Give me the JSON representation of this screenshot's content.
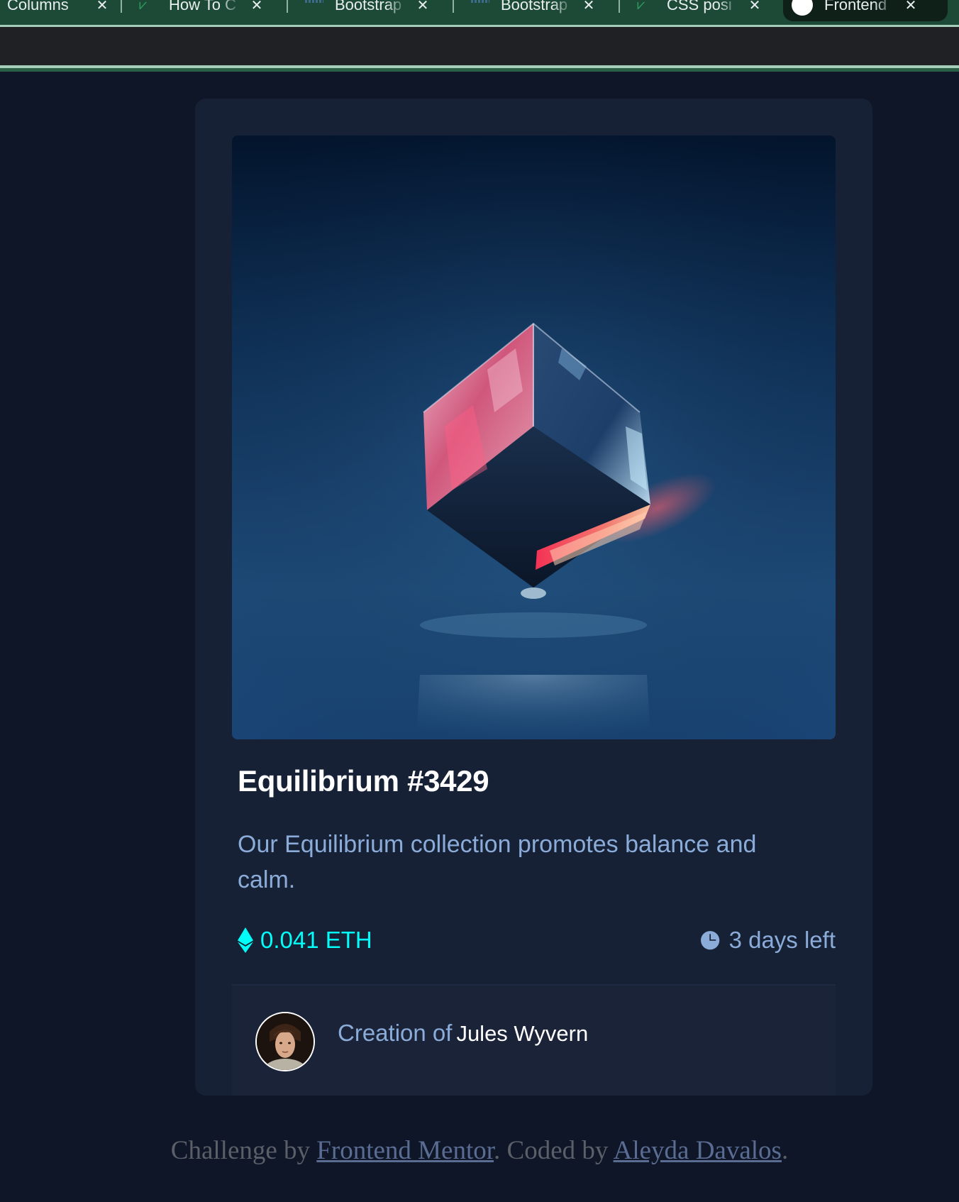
{
  "browser": {
    "tabs": [
      {
        "label": "Columns",
        "icon": "document-icon",
        "active": false
      },
      {
        "label": "How To C",
        "icon": "w3schools-icon",
        "active": false
      },
      {
        "label": "Bootstrap",
        "icon": "bars-favicon-icon",
        "active": false
      },
      {
        "label": "Bootstrap",
        "icon": "bars-favicon-icon",
        "active": false
      },
      {
        "label": "CSS posi",
        "icon": "w3schools-icon",
        "active": false
      },
      {
        "label": "Frontend",
        "icon": "frontend-mentor-icon",
        "active": true
      }
    ],
    "close_glyph": "✕"
  },
  "card": {
    "image_alt": "Equilibrium",
    "title": "Equilibrium #3429",
    "description": "Our Equilibrium collection promotes balance and calm.",
    "price": "0.041 ETH",
    "time_left": "3 days left",
    "creator_prefix": "Creation of",
    "creator_name": "Jules Wyvern",
    "colors": {
      "card_bg": "#172136",
      "page_bg": "#0e1627",
      "cyan": "#00fff8",
      "soft_blue": "#8bacd9",
      "white": "#ffffff"
    }
  },
  "attribution": {
    "prefix": "Challenge by",
    "link1": "Frontend Mentor",
    "middle": ". Coded by",
    "link2": "Aleyda Davalos",
    "suffix": "."
  }
}
